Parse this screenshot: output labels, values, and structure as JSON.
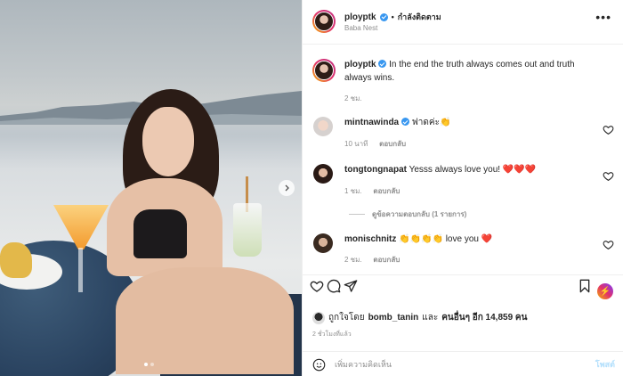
{
  "post": {
    "username": "ployptk",
    "separator": "•",
    "follow_label": "กำลังติดตาม",
    "location": "Baba Nest",
    "more_label": "•••"
  },
  "caption": {
    "username": "ployptk",
    "text": "In the end the truth always comes out and truth always wins.",
    "time": "2 ชม."
  },
  "comments": [
    {
      "username": "mintnawinda",
      "verified": true,
      "text": "ฟาดค่ะ👏",
      "time": "10 นาที",
      "reply": "ตอบกลับ"
    },
    {
      "username": "tongtongnapat",
      "verified": false,
      "text": "Yesss always love you! ❤️❤️❤️",
      "time": "1 ชม.",
      "reply": "ตอบกลับ"
    },
    {
      "username": "monischnitz",
      "verified": false,
      "text": "👏👏👏👏 love you ❤️",
      "time": "2 ชม.",
      "reply": "ตอบกลับ"
    }
  ],
  "view_replies": "ดูข้อความตอบกลับ (1 รายการ)",
  "likes": {
    "prefix": "ถูกใจโดย",
    "user": "bomb_tanin",
    "middle": "และ",
    "others": "คนอื่นๆ อีก 14,859 คน"
  },
  "posted_ago": "2 ชั่วโมงที่แล้ว",
  "comment_box": {
    "placeholder": "เพิ่มความคิดเห็น",
    "post_label": "โพสต์"
  },
  "carousel": {
    "slide_count": 2,
    "active_index": 0
  },
  "colors": {
    "verified": "#3897f0",
    "heart_red": "#ed4956",
    "muted": "#8e8e8e"
  }
}
